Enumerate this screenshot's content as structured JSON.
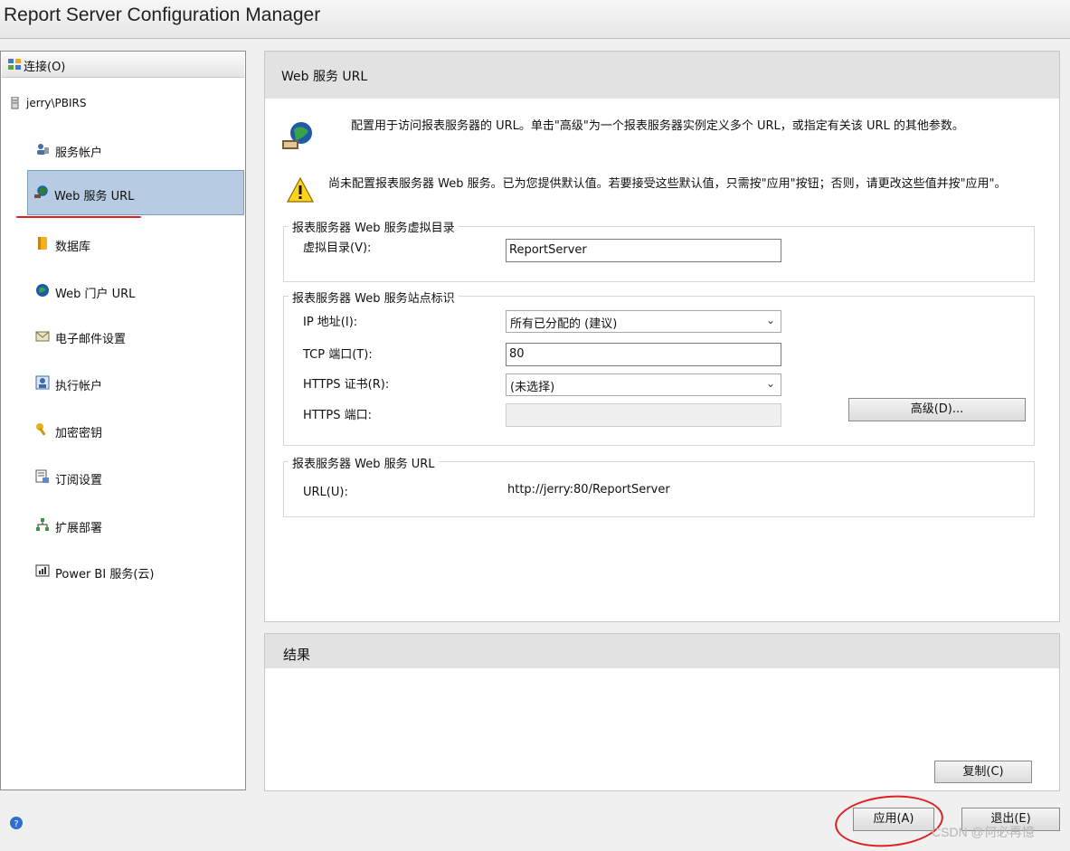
{
  "window": {
    "title": "Report Server Configuration Manager"
  },
  "sidebar": {
    "connect_label": "连接(O)",
    "server": "jerry\\PBIRS",
    "items": [
      {
        "label": "服务帐户",
        "icon": "service-account-icon"
      },
      {
        "label": "Web 服务 URL",
        "icon": "web-service-icon",
        "selected": true
      },
      {
        "label": "数据库",
        "icon": "database-icon"
      },
      {
        "label": "Web 门户 URL",
        "icon": "globe-icon"
      },
      {
        "label": "电子邮件设置",
        "icon": "email-icon"
      },
      {
        "label": "执行帐户",
        "icon": "execution-account-icon"
      },
      {
        "label": "加密密钥",
        "icon": "key-icon"
      },
      {
        "label": "订阅设置",
        "icon": "subscription-icon"
      },
      {
        "label": "扩展部署",
        "icon": "deployment-icon"
      },
      {
        "label": "Power BI 服务(云)",
        "icon": "powerbi-icon"
      }
    ]
  },
  "main": {
    "header": "Web 服务 URL",
    "intro": "配置用于访问报表服务器的 URL。单击\"高级\"为一个报表服务器实例定义多个 URL，或指定有关该 URL 的其他参数。",
    "warning": "尚未配置报表服务器 Web 服务。已为您提供默认值。若要接受这些默认值，只需按\"应用\"按钮；否则，请更改这些值并按\"应用\"。",
    "vdir_group": {
      "title": "报表服务器 Web 服务虚拟目录",
      "label": "虚拟目录(V):",
      "value": "ReportServer"
    },
    "site_group": {
      "title": "报表服务器 Web 服务站点标识",
      "ip_label": "IP 地址(I):",
      "ip_value": "所有已分配的 (建议)",
      "tcp_label": "TCP 端口(T):",
      "tcp_value": "80",
      "https_cert_label": "HTTPS 证书(R):",
      "https_cert_value": "(未选择)",
      "https_port_label": "HTTPS 端口:",
      "https_port_value": "",
      "advanced_button": "高级(D)..."
    },
    "url_group": {
      "title": "报表服务器 Web 服务 URL",
      "label": "URL(U):",
      "value": "http://jerry:80/ReportServer"
    }
  },
  "results": {
    "header": "结果",
    "copy_button": "复制(C)"
  },
  "footer": {
    "apply_button": "应用(A)",
    "exit_button": "退出(E)",
    "help_icon": "help-icon"
  },
  "watermark": "CSDN @何必再憶",
  "colors": {
    "selected_bg": "#b7cbe2",
    "annotation_red": "#e0201f",
    "header_bg": "#e2e2e2"
  }
}
